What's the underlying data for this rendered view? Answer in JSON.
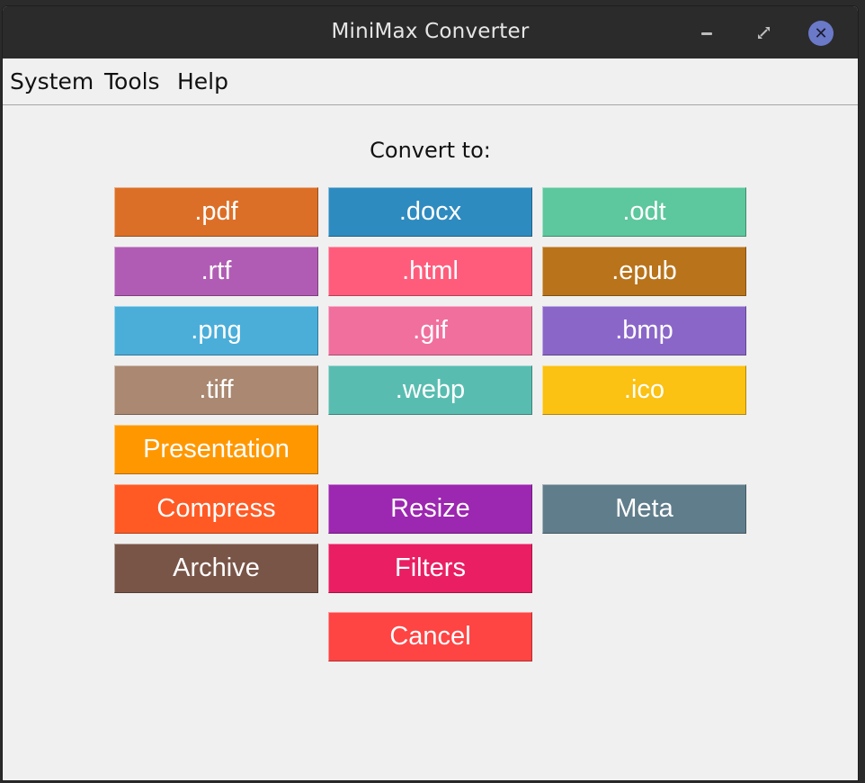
{
  "window": {
    "title": "MiniMax Converter",
    "controls": [
      "minimize-icon",
      "maximize-icon",
      "close-icon"
    ],
    "close_glyph": "✕"
  },
  "menu": {
    "items": [
      "System",
      "Tools",
      "Help"
    ]
  },
  "main": {
    "heading": "Convert to:",
    "formats": [
      {
        "label": ".pdf",
        "color": "#dc6f27"
      },
      {
        "label": ".docx",
        "color": "#2e8bc0"
      },
      {
        "label": ".odt",
        "color": "#5dc79d"
      },
      {
        "label": ".rtf",
        "color": "#b05cb4"
      },
      {
        "label": ".html",
        "color": "#ff5c7c"
      },
      {
        "label": ".epub",
        "color": "#b8731b"
      },
      {
        "label": ".png",
        "color": "#4aaed9"
      },
      {
        "label": ".gif",
        "color": "#f06f9d"
      },
      {
        "label": ".bmp",
        "color": "#8a66c9"
      },
      {
        "label": ".tiff",
        "color": "#aa8871"
      },
      {
        "label": ".webp",
        "color": "#58bdb0"
      },
      {
        "label": ".ico",
        "color": "#fbc113"
      }
    ],
    "presentation": {
      "label": "Presentation",
      "color": "#ff9800"
    },
    "tools": [
      {
        "label": "Compress",
        "color": "#ff5a24"
      },
      {
        "label": "Resize",
        "color": "#9c27b0"
      },
      {
        "label": "Meta",
        "color": "#607d8b"
      },
      {
        "label": "Archive",
        "color": "#795548"
      },
      {
        "label": "Filters",
        "color": "#e91e63"
      }
    ],
    "cancel": {
      "label": "Cancel",
      "color": "#ff4444"
    }
  }
}
